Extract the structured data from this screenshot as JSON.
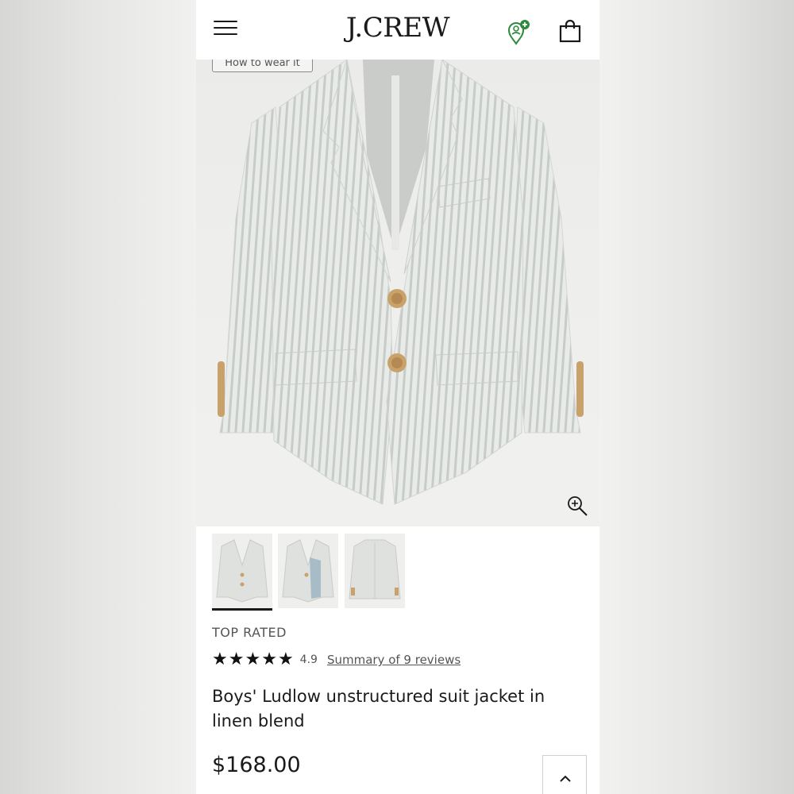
{
  "header": {
    "brand": "J.CREW",
    "menu_icon": "hamburger-menu-icon",
    "location_icon": "store-locator-icon",
    "bag_icon": "shopping-bag-icon"
  },
  "hero": {
    "how_to_wear_label": "How to wear it",
    "zoom_icon": "zoom-in-icon"
  },
  "thumbnails": [
    {
      "view": "front",
      "selected": true
    },
    {
      "view": "open-lining",
      "selected": false
    },
    {
      "view": "back",
      "selected": false
    }
  ],
  "product": {
    "badge": "TOP RATED",
    "rating_value": "4.9",
    "rating_stars": 5,
    "reviews_link": "Summary of 9 reviews",
    "name": "Boys' Ludlow unstructured suit jacket in linen blend",
    "price": "$168.00"
  },
  "colors": {
    "text": "#1a1a1a",
    "muted": "#555555",
    "locator_accent": "#2e8b3e"
  }
}
